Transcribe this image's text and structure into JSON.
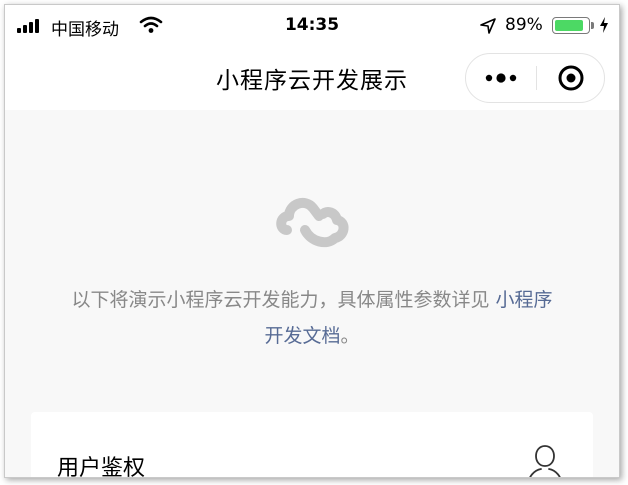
{
  "status_bar": {
    "carrier": "中国移动",
    "time": "14:35",
    "battery_percent": "89%",
    "battery_level": 0.89,
    "icons": [
      "signal-icon",
      "wifi-icon",
      "location-arrow-icon",
      "battery-icon",
      "charging-icon"
    ]
  },
  "nav": {
    "title": "小程序云开发展示",
    "capsule": {
      "more_icon": "more-dots-icon",
      "close_icon": "close-circle-icon"
    }
  },
  "main": {
    "logo_icon": "cloud-logo-icon",
    "intro_text": "以下将演示小程序云开发能力，具体属性参数详见",
    "intro_link": "小程序开发文档",
    "intro_end": "。",
    "cards": [
      {
        "title": "用户鉴权",
        "icon": "user-icon"
      }
    ]
  },
  "colors": {
    "background": "#f8f8f8",
    "link": "#576b95",
    "muted_text": "#888888",
    "battery_green": "#4cd964"
  }
}
